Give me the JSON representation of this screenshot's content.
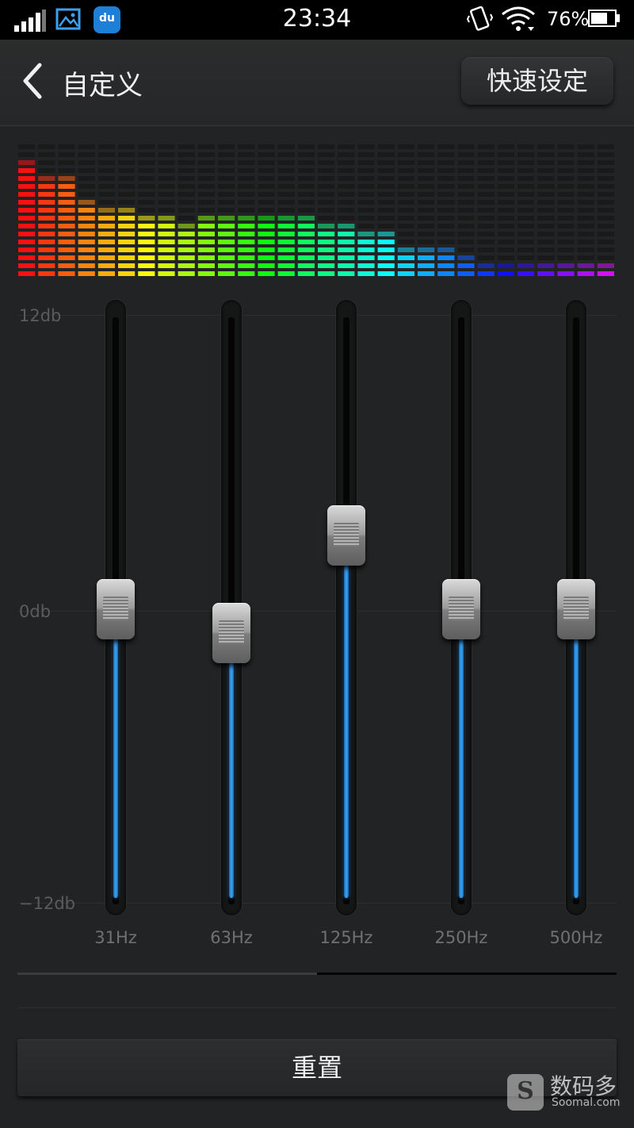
{
  "status_bar": {
    "time": "23:34",
    "battery_percent": "76%",
    "battery_level": 0.76,
    "icons": [
      "signal-icon",
      "gallery-icon",
      "baidu-du-icon",
      "vibrate-icon",
      "wifi-icon",
      "battery-icon"
    ],
    "du_label": "du"
  },
  "header": {
    "title": "自定义",
    "quick_settings_label": "快速设定"
  },
  "equalizer": {
    "db_labels": {
      "top": "12db",
      "middle": "0db",
      "bottom": "−12db"
    },
    "db_range": [
      -12,
      12
    ],
    "bands": [
      {
        "label": "31Hz",
        "gain_db": 0
      },
      {
        "label": "63Hz",
        "gain_db": -1
      },
      {
        "label": "125Hz",
        "gain_db": 3
      },
      {
        "label": "250Hz",
        "gain_db": 0
      },
      {
        "label": "500Hz",
        "gain_db": 0
      }
    ],
    "accent_color": "#3ea3f0"
  },
  "spectrum": {
    "bar_levels": [
      0.88,
      0.76,
      0.76,
      0.6,
      0.53,
      0.53,
      0.47,
      0.47,
      0.41,
      0.47,
      0.47,
      0.47,
      0.47,
      0.47,
      0.47,
      0.41,
      0.41,
      0.35,
      0.35,
      0.24,
      0.24,
      0.24,
      0.18,
      0.12,
      0.12,
      0.12,
      0.12,
      0.12,
      0.12,
      0.12
    ]
  },
  "reset_label": "重置",
  "watermark": {
    "name": "数码多",
    "site": "Soomal.com",
    "logo_letter": "S"
  }
}
